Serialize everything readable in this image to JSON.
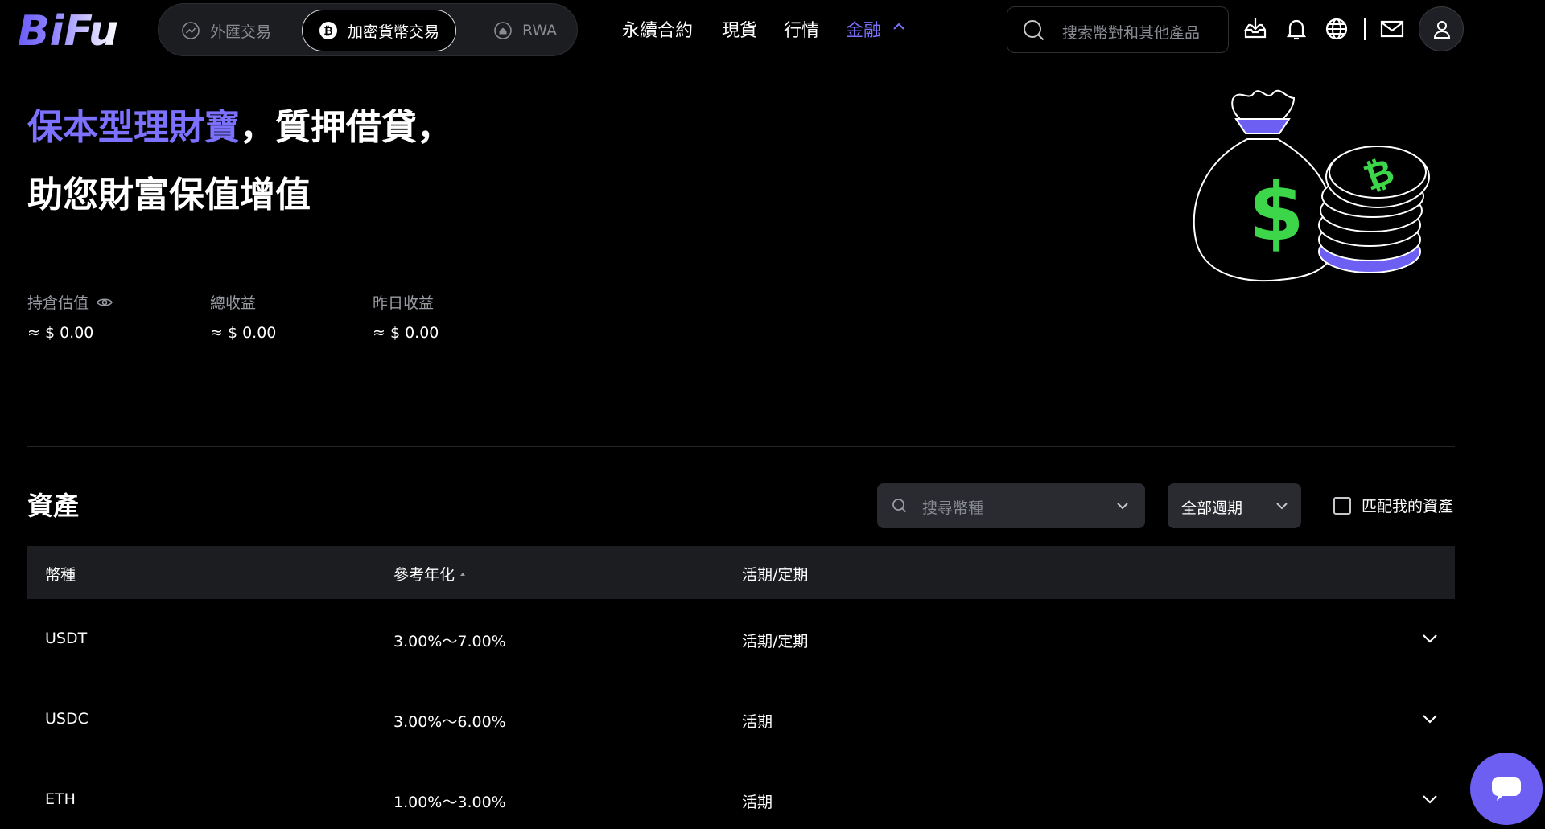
{
  "brand": {
    "logo_text": "BiFu",
    "accent_color": "#7d72ff"
  },
  "header": {
    "modes": [
      {
        "label": "外匯交易",
        "icon": "trend-icon",
        "active": false
      },
      {
        "label": "加密貨幣交易",
        "icon": "bitcoin-icon",
        "active": true
      },
      {
        "label": "RWA",
        "icon": "home-icon",
        "active": false
      }
    ],
    "nav": [
      {
        "label": "永續合約"
      },
      {
        "label": "現貨"
      },
      {
        "label": "行情"
      },
      {
        "label": "金融",
        "active": true,
        "icon": "chevron-up-icon"
      }
    ],
    "search": {
      "placeholder": "搜索幣對和其他產品"
    },
    "tools": [
      "download-icon",
      "bell-icon",
      "globe-icon",
      "mail-icon",
      "user-icon"
    ]
  },
  "hero": {
    "highlight": "保本型理財寶",
    "line1_rest": "，質押借貸，",
    "line2": "助您財富保值增值",
    "illustration": "money-bag-with-coins"
  },
  "stats": [
    {
      "label": "持倉估值",
      "value": "≈ $ 0.00",
      "icon": "eye-icon"
    },
    {
      "label": "總收益",
      "value": "≈ $ 0.00"
    },
    {
      "label": "昨日收益",
      "value": "≈ $ 0.00"
    }
  ],
  "assets": {
    "title": "資產",
    "search": {
      "placeholder": "搜尋幣種"
    },
    "period": {
      "value": "全部週期"
    },
    "match": {
      "label": "匹配我的資產",
      "checked": false
    },
    "columns": [
      "幣種",
      "參考年化",
      "活期/定期"
    ],
    "rows": [
      {
        "coin": "USDT",
        "apr": "3.00%～7.00%",
        "term": "活期/定期"
      },
      {
        "coin": "USDC",
        "apr": "3.00%～6.00%",
        "term": "活期"
      },
      {
        "coin": "ETH",
        "apr": "1.00%～3.00%",
        "term": "活期"
      }
    ]
  },
  "chat": {
    "icon": "chat-icon"
  }
}
